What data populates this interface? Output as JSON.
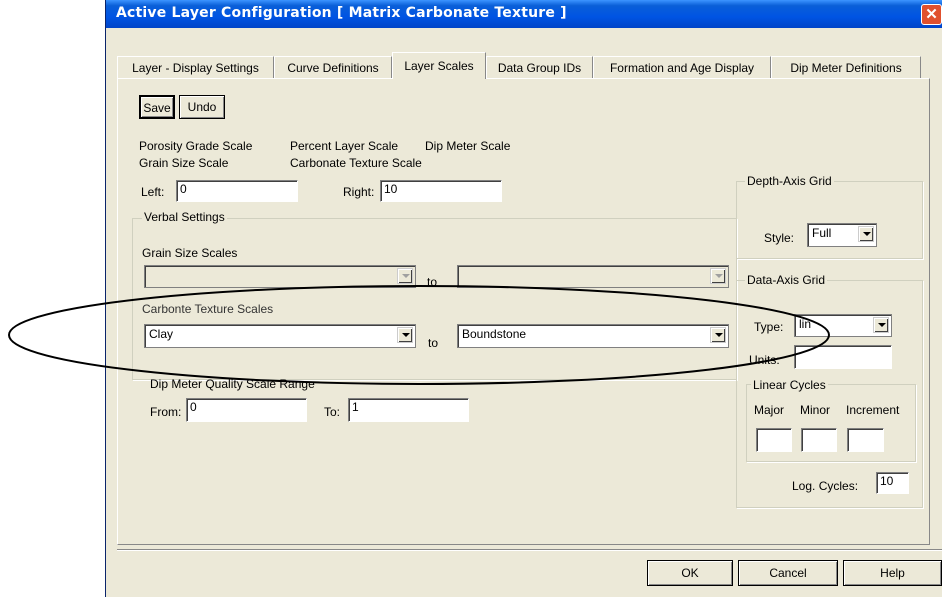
{
  "window": {
    "title": "Active Layer Configuration   [ Matrix Carbonate Texture ]",
    "close_glyph": "✕"
  },
  "tabs": [
    {
      "label": "Layer - Display Settings"
    },
    {
      "label": "Curve Definitions"
    },
    {
      "label": "Layer Scales"
    },
    {
      "label": "Data Group IDs"
    },
    {
      "label": "Formation and Age Display"
    },
    {
      "label": "Dip Meter Definitions"
    }
  ],
  "toolbar": {
    "save_label": "Save",
    "undo_label": "Undo"
  },
  "scale_types": {
    "row1": [
      "Porosity Grade Scale",
      "Percent Layer Scale",
      "Dip Meter Scale"
    ],
    "row2": [
      "Grain Size Scale",
      "Carbonate Texture Scale"
    ]
  },
  "range": {
    "left_label": "Left:",
    "left_value": "0",
    "right_label": "Right:",
    "right_value": "10"
  },
  "verbal": {
    "legend": "Verbal Settings",
    "grain_label": "Grain Size Scales",
    "grain_from": "",
    "grain_to": "",
    "to_label": "to",
    "carbonate_label": "Carbonte Texture Scales",
    "carbonate_from": "Clay",
    "carbonate_to": "Boundstone"
  },
  "dip": {
    "label": "Dip Meter Quality Scale Range",
    "from_label": "From:",
    "from_value": "0",
    "to_label": "To:",
    "to_value": "1"
  },
  "depth_grid": {
    "legend": "Depth-Axis Grid",
    "style_label": "Style:",
    "style_value": "Full"
  },
  "data_grid": {
    "legend": "Data-Axis Grid",
    "type_label": "Type:",
    "type_value": "lin",
    "units_label": "Units:",
    "units_value": "",
    "linear_legend": "Linear Cycles",
    "major_label": "Major",
    "minor_label": "Minor",
    "increment_label": "Increment",
    "major_value": "",
    "minor_value": "",
    "increment_value": "",
    "log_label": "Log. Cycles:",
    "log_value": "10"
  },
  "footer": {
    "ok_label": "OK",
    "cancel_label": "Cancel",
    "help_label": "Help"
  },
  "colors": {
    "titlebar": "#0054e3",
    "dialog": "#ece9d8",
    "annotation": "#000000"
  }
}
